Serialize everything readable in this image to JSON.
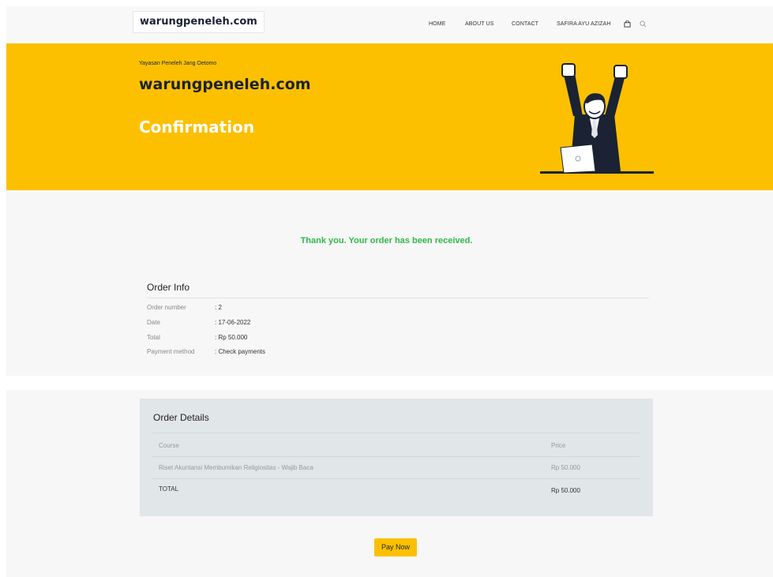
{
  "header": {
    "logo": "warungpeneleh.com",
    "nav": {
      "home": "HOME",
      "about": "ABOUT US",
      "contact": "CONTACT",
      "user": "SAFIRA AYU AZIZAH"
    },
    "icons": [
      "bag-icon",
      "search-icon"
    ]
  },
  "hero": {
    "subtitle": "Yayasan Peneleh Jang Oetomo",
    "title": "warungpeneleh.com",
    "heading": "Confirmation",
    "background": "#fcc000"
  },
  "order": {
    "thank_you": "Thank you. Your order has been received.",
    "info_title": "Order Info",
    "rows": [
      {
        "label": "Order number",
        "value": ": 2"
      },
      {
        "label": "Date",
        "value": ": 17-06-2022"
      },
      {
        "label": "Total",
        "value": ": Rp 50.000"
      },
      {
        "label": "Payment method",
        "value": ": Check payments"
      }
    ]
  },
  "details": {
    "title": "Order Details",
    "col_course": "Course",
    "col_price": "Price",
    "item_name": "Riset Akuntansi Membumikan Religiositas - Wajib Baca",
    "item_price": "Rp 50.000",
    "total_label": "TOTAL",
    "total_value": "Rp 50.000"
  },
  "pay_button": "Pay Now",
  "colors": {
    "accent": "#fcc000",
    "success": "#2fb84a",
    "navy": "#1a2233"
  }
}
